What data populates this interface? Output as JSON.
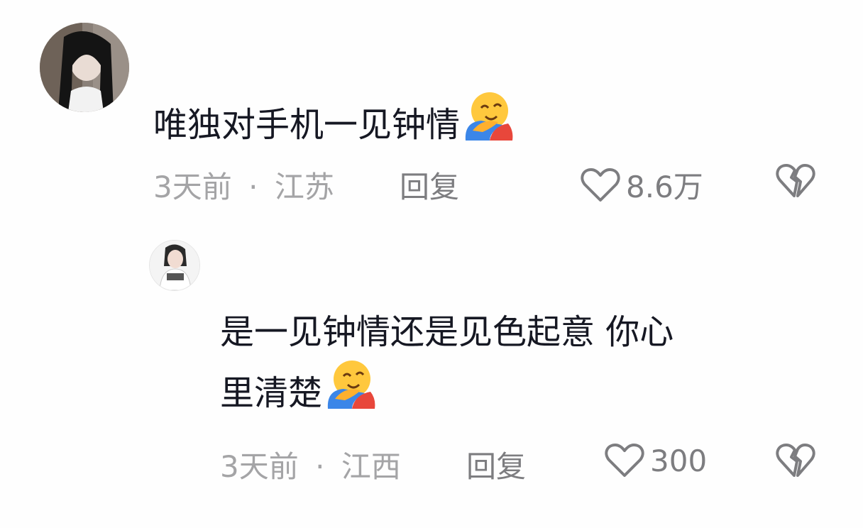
{
  "comments": [
    {
      "text": "唯独对手机一见钟情",
      "emoji": "hugging-face-emoji",
      "time": "3天前",
      "separator": "·",
      "location": "江苏",
      "reply_label": "回复",
      "likes": "8.6万"
    },
    {
      "text_line1": "是一见钟情还是见色起意 你心",
      "text_line2": "里清楚",
      "emoji": "hugging-face-emoji",
      "time": "3天前",
      "separator": "·",
      "location": "江西",
      "reply_label": "回复",
      "likes": "300"
    }
  ],
  "icons": {
    "like": "heart-outline-icon",
    "dislike": "broken-heart-icon"
  },
  "colors": {
    "text": "#161823",
    "meta": "#a4a4a6",
    "action": "#7d7d80",
    "background": "#fefefe"
  }
}
